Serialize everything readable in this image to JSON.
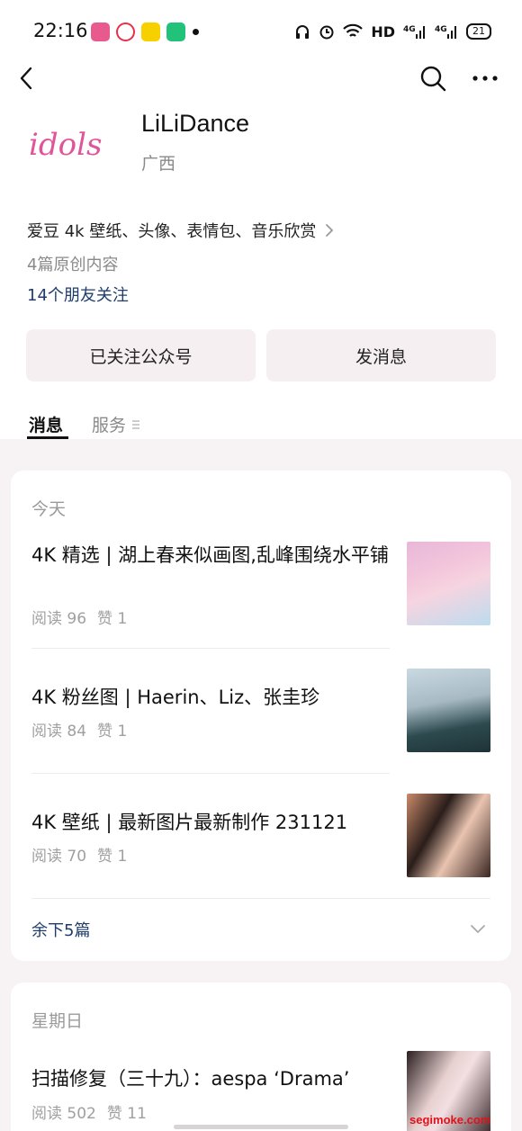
{
  "status_bar": {
    "time": "22:16",
    "network_label": "HD",
    "battery": "21"
  },
  "account": {
    "logo_text": "idols",
    "name": "LiLiDance",
    "region": "广西",
    "description": "爱豆 4k 壁纸、头像、表情包、音乐欣赏",
    "original_count": "4篇原创内容",
    "friends_following": "14个朋友关注"
  },
  "actions": {
    "follow_label": "已关注公众号",
    "message_label": "发消息"
  },
  "tabs": {
    "messages": "消息",
    "services": "服务"
  },
  "groups": [
    {
      "date": "今天",
      "articles": [
        {
          "title": "4K 精选 | 湖上春来似画图,乱峰围绕水平铺",
          "reads": "阅读 96",
          "likes": "赞 1"
        },
        {
          "title": "4K 粉丝图 | Haerin、Liz、张圭珍",
          "reads": "阅读 84",
          "likes": "赞 1"
        },
        {
          "title": "4K 壁纸 | 最新图片最新制作 231121",
          "reads": "阅读 70",
          "likes": "赞 1"
        }
      ],
      "more": "余下5篇"
    },
    {
      "date": "星期日",
      "articles": [
        {
          "title": "扫描修复（三十九）：aespa ‘Drama’",
          "reads": "阅读 502",
          "likes": "赞 11"
        }
      ]
    }
  ],
  "watermark": "segimoke.com",
  "colors": {
    "page_bg": "#f7f2f4",
    "link_blue": "#1e3d6e",
    "button_bg": "#f5eff2",
    "logo_pink": "#e0559a"
  }
}
